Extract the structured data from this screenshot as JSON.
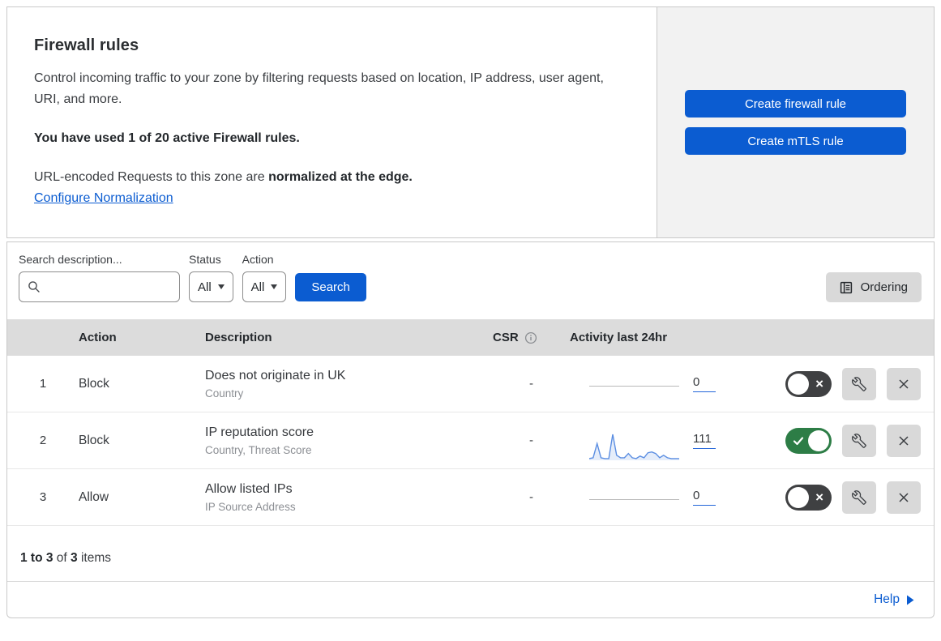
{
  "header": {
    "title": "Firewall rules",
    "description": "Control incoming traffic to your zone by filtering requests based on location, IP address, user agent, URI, and more.",
    "usage": "You have used 1 of 20 active Firewall rules.",
    "normalization_prefix": "URL-encoded Requests to this zone are ",
    "normalization_bold": "normalized at the edge.",
    "normalization_link": "Configure Normalization",
    "buttons": [
      {
        "label": "Create firewall rule"
      },
      {
        "label": "Create mTLS rule"
      }
    ]
  },
  "filters": {
    "search_label": "Search description...",
    "status_label": "Status",
    "status_value": "All",
    "action_label": "Action",
    "action_value": "All",
    "search_button": "Search",
    "ordering_button": "Ordering"
  },
  "table": {
    "columns": {
      "action": "Action",
      "description": "Description",
      "csr": "CSR",
      "activity": "Activity last 24hr"
    },
    "rows": [
      {
        "priority": "1",
        "action": "Block",
        "description": "Does not originate in UK",
        "fields": "Country",
        "csr": "-",
        "activity_count": "0",
        "enabled": false,
        "has_sparkline": false
      },
      {
        "priority": "2",
        "action": "Block",
        "description": "IP reputation score",
        "fields": "Country, Threat Score",
        "csr": "-",
        "activity_count": "111",
        "enabled": true,
        "has_sparkline": true
      },
      {
        "priority": "3",
        "action": "Allow",
        "description": "Allow listed IPs",
        "fields": "IP Source Address",
        "csr": "-",
        "activity_count": "0",
        "enabled": false,
        "has_sparkline": false
      }
    ]
  },
  "footer": {
    "range": "1 to 3",
    "of": "of",
    "total": "3",
    "items": "items",
    "help_label": "Help"
  },
  "colors": {
    "accent": "#0b5cd1",
    "toggle_on": "#2d7d46",
    "toggle_off": "#3f4042",
    "spark": "#5b8ee2"
  },
  "chart_data": {
    "type": "area",
    "label": "Activity last 24hr sparkline for rule 2 (IP reputation score)",
    "total_shown": "111",
    "x_range": "last 24 hours (values estimated from sparkline shape)",
    "values": [
      2,
      3,
      20,
      3,
      2,
      2,
      31,
      6,
      3,
      3,
      8,
      3,
      2,
      5,
      3,
      9,
      10,
      8,
      3,
      6,
      3,
      2,
      2,
      2
    ],
    "color": "#5b8ee2",
    "fill": "rgba(91,142,226,0.16)",
    "legend": "none",
    "grid": false
  }
}
